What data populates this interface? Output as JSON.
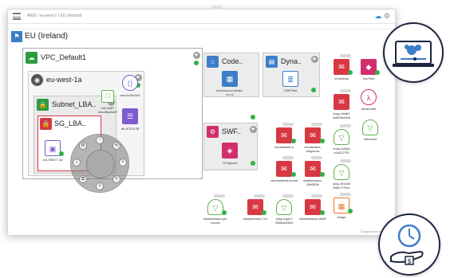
{
  "header": {
    "breadcrumb": "AWS / eu-west-1 / EU (Ireland)",
    "icons": [
      "cloud-icon",
      "gear-icon"
    ]
  },
  "region": {
    "label": "EU (Ireland)"
  },
  "vpc": {
    "label": "VPC_Default1"
  },
  "az": {
    "label": "eu-west-1a"
  },
  "subnet": {
    "label": "Subnet_LBA.."
  },
  "sg": {
    "label": "SG_LBA.."
  },
  "codecommit": {
    "label": "Code.."
  },
  "dynamo": {
    "label": "Dyna.."
  },
  "swf": {
    "label": "SWF.."
  },
  "services": [
    {
      "id": "eni",
      "caption": "eni-0f0b77 3a"
    },
    {
      "id": "nat",
      "caption": "nat-0a3f7 61ed8ba0d27"
    },
    {
      "id": "ami",
      "caption": "ami-bc2fa 60c"
    },
    {
      "id": "rtb",
      "caption": "rtb-87229 2ff"
    },
    {
      "id": "codecommit",
      "caption": "amzncocod ebuild-cc-nx"
    },
    {
      "id": "cwe",
      "caption": "CWETest"
    },
    {
      "id": "swf-domain",
      "caption": "STUpload"
    }
  ],
  "grid": [
    {
      "id": "sq1",
      "caption": "cf-lambda"
    },
    {
      "id": "sq2",
      "caption": "DevTest"
    },
    {
      "id": "lam",
      "caption": "dynamodb"
    },
    {
      "id": "s3a",
      "caption": "s3bucket"
    },
    {
      "id": "sq3",
      "caption": "snsp-d0a82 4c6f2fea3bd"
    },
    {
      "id": "sq4",
      "caption": "cloudwatch-a"
    },
    {
      "id": "sq5",
      "caption": "cloudwatch-alogsnow"
    },
    {
      "id": "sq6",
      "caption": "snsp-426a6 e1a2127f0"
    },
    {
      "id": "sq7",
      "caption": "cloudwatchdocument"
    },
    {
      "id": "sq8",
      "caption": "elasticbeans-38b383b"
    },
    {
      "id": "sq9",
      "caption": "snsp-6f1040 845c77f7ea"
    },
    {
      "id": "s3b",
      "caption": "elasticbeans-lpb-cloudn"
    },
    {
      "id": "sq10",
      "caption": "elasticbeans-719"
    },
    {
      "id": "sq11",
      "caption": "snsp-logic-f 2586464603"
    },
    {
      "id": "sq12",
      "caption": "elasticbeans-ckNR"
    },
    {
      "id": "img",
      "caption": "Image"
    }
  ],
  "statusbar": {
    "text": "Diagram bar info Help"
  },
  "colors": {
    "red": "#d93843",
    "purple": "#7d5bd0",
    "pink": "#d22e6e",
    "blue": "#3d7dc9",
    "green": "#2fb24a"
  }
}
